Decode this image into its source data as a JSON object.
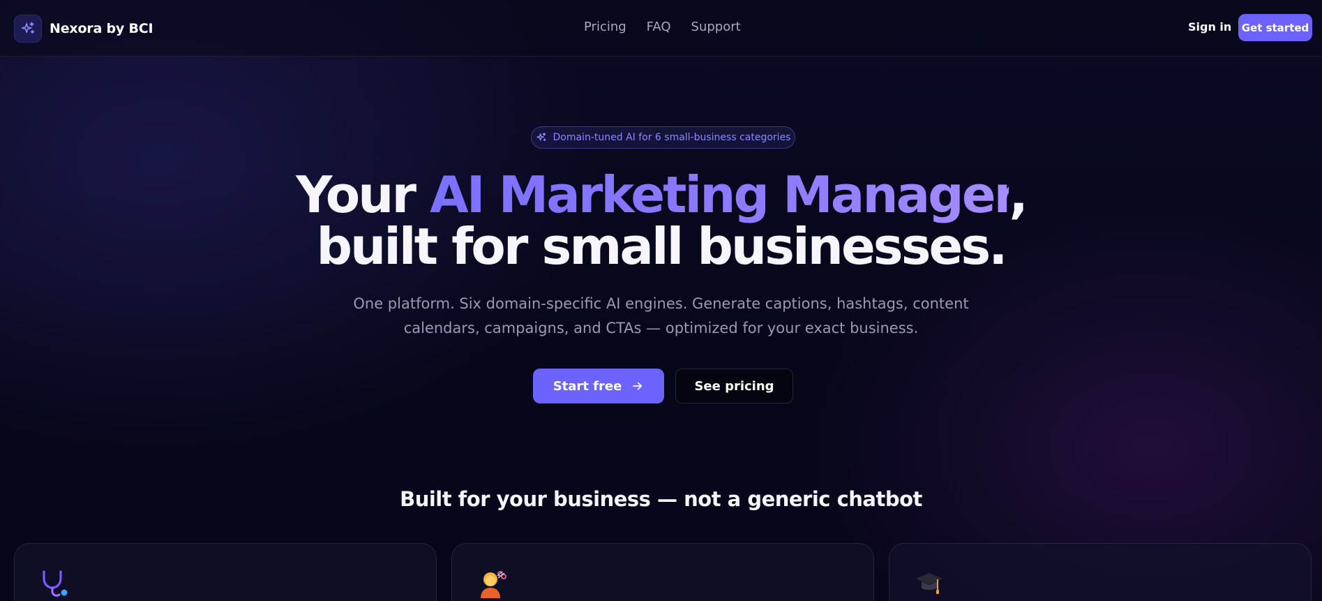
{
  "nav": {
    "brand": "Nexora by BCI",
    "brand_icon": "sparkles-icon",
    "links": [
      "Pricing",
      "FAQ",
      "Support"
    ],
    "sign_in": "Sign in",
    "get_started": "Get started"
  },
  "hero": {
    "badge_icon": "sparkles-icon",
    "badge": "Domain-tuned AI for 6 small-business categories",
    "title_prefix": "Your ",
    "title_accent": "AI Marketing Manager",
    "title_suffix": ",",
    "title_line2": "built for small businesses.",
    "subtitle": "One platform. Six domain-specific AI engines. Generate captions, hashtags, content calendars, campaigns, and CTAs — optimized for your exact business.",
    "primary_cta": "Start free",
    "primary_cta_icon": "arrow-right-icon",
    "secondary_cta": "See pricing"
  },
  "section": {
    "title": "Built for your business — not a generic chatbot",
    "cards": [
      {
        "icon": "stethoscope-icon"
      },
      {
        "icon": "haircut-person-icon"
      },
      {
        "icon": "graduation-cap-icon"
      }
    ]
  },
  "colors": {
    "accent": "#6c63ff",
    "background": "#07071a",
    "text_muted": "#9a9ab4"
  }
}
